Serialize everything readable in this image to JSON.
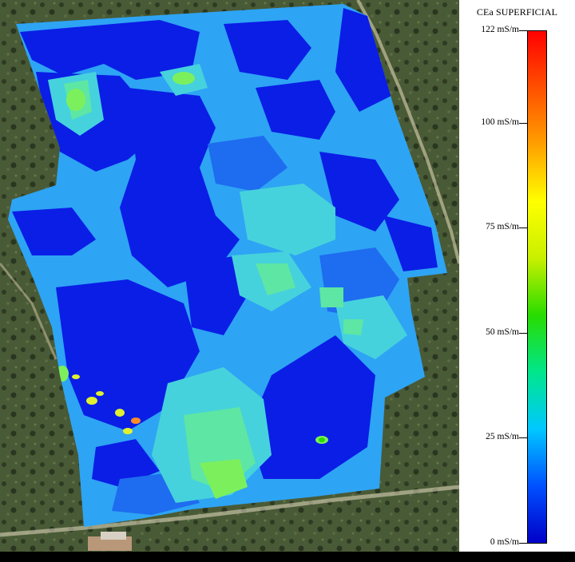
{
  "legend": {
    "title": "CEa SUPERFICIAL",
    "unit": "mS/m",
    "min": 0,
    "max": 122,
    "ticks": [
      {
        "value": 122,
        "label": "122 mS/m"
      },
      {
        "value": 100,
        "label": "100 mS/m"
      },
      {
        "value": 75,
        "label": "75 mS/m"
      },
      {
        "value": 50,
        "label": "50 mS/m"
      },
      {
        "value": 25,
        "label": "25 mS/m"
      },
      {
        "value": 0,
        "label": "0 mS/m"
      }
    ],
    "gradient": [
      "#0000c8",
      "#0050ff",
      "#00c8ff",
      "#00e68c",
      "#28dc00",
      "#c8f000",
      "#ffff00",
      "#ffa000",
      "#ff5000",
      "#ff0000"
    ]
  },
  "map": {
    "palette": {
      "background_satellite": "#4a5a38",
      "very_low": "#0a1ee6",
      "low": "#1e6cf0",
      "mid_low": "#2ea4f4",
      "mid": "#46d2dc",
      "mid_high": "#5ee6a4",
      "high": "#7cf05c",
      "peak": "#e0f030"
    }
  }
}
